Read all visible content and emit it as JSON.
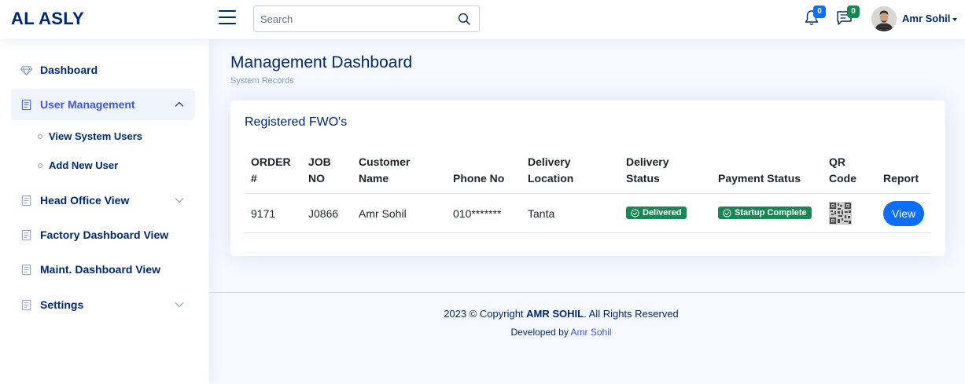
{
  "header": {
    "logo": "AL ASLY",
    "search_placeholder": "Search",
    "notifications_count": "0",
    "messages_count": "0",
    "user_name": "Amr Sohil"
  },
  "sidebar": {
    "items": [
      {
        "label": "Dashboard",
        "icon": "gem-icon"
      },
      {
        "label": "User Management",
        "icon": "document-icon",
        "active": true
      },
      {
        "label": "Head Office View",
        "icon": "document-icon"
      },
      {
        "label": "Factory Dashboard View",
        "icon": "document-icon"
      },
      {
        "label": "Maint. Dashboard View",
        "icon": "document-icon"
      },
      {
        "label": "Settings",
        "icon": "document-icon"
      }
    ],
    "sub_items": [
      {
        "label": "View System Users"
      },
      {
        "label": "Add New User"
      }
    ]
  },
  "main": {
    "title": "Management Dashboard",
    "subtitle": "System Records",
    "card_title": "Registered FWO's",
    "columns": [
      "ORDER #",
      "JOB NO",
      "Customer Name",
      "Phone No",
      "Delivery Location",
      "Delivery Status",
      "Payment Status",
      "QR Code",
      "Report"
    ],
    "rows": [
      {
        "order": "9171",
        "job_no": "J0866",
        "customer": "Amr Sohil",
        "phone": "010*******",
        "location": "Tanta",
        "delivery_status": "Delivered",
        "payment_status": "Startup Complete",
        "report_button": "View"
      }
    ]
  },
  "footer": {
    "copyright_prefix": "2023 © Copyright ",
    "copyright_name": "AMR SOHIL",
    "copyright_suffix": ". All Rights Reserved",
    "developed_prefix": "Developed by ",
    "developed_name": "Amr Sohil"
  },
  "colors": {
    "primary": "#012970",
    "accent": "#4154f1",
    "success": "#198754",
    "button": "#0d6efd"
  }
}
